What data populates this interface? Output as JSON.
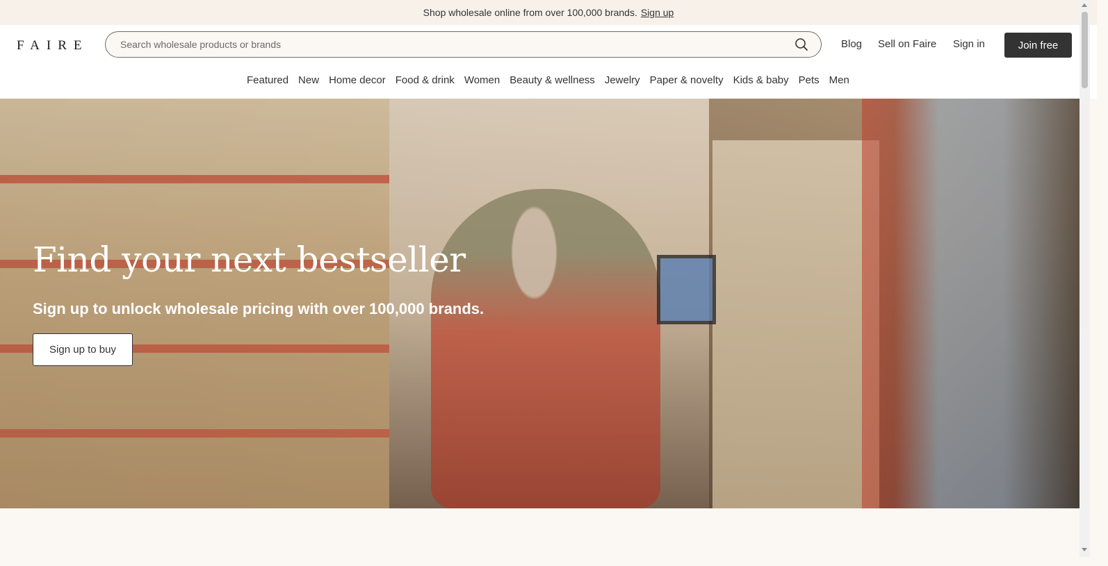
{
  "promo": {
    "text": "Shop wholesale online from over 100,000 brands.",
    "link": "Sign up"
  },
  "header": {
    "logo": "FAIRE",
    "search_placeholder": "Search wholesale products or brands",
    "links": {
      "blog": "Blog",
      "sell": "Sell on Faire",
      "signin": "Sign in"
    },
    "join_label": "Join free"
  },
  "nav": {
    "items": [
      "Featured",
      "New",
      "Home decor",
      "Food & drink",
      "Women",
      "Beauty & wellness",
      "Jewelry",
      "Paper & novelty",
      "Kids & baby",
      "Pets",
      "Men"
    ]
  },
  "hero": {
    "title": "Find your next bestseller",
    "subtitle": "Sign up to unlock wholesale pricing with over 100,000 brands.",
    "cta": "Sign up to buy"
  },
  "icons": {
    "search": "search-icon"
  },
  "colors": {
    "join_bg": "#333333",
    "promo_bg": "#f7f1ea",
    "page_bg": "#fbf7f3"
  }
}
